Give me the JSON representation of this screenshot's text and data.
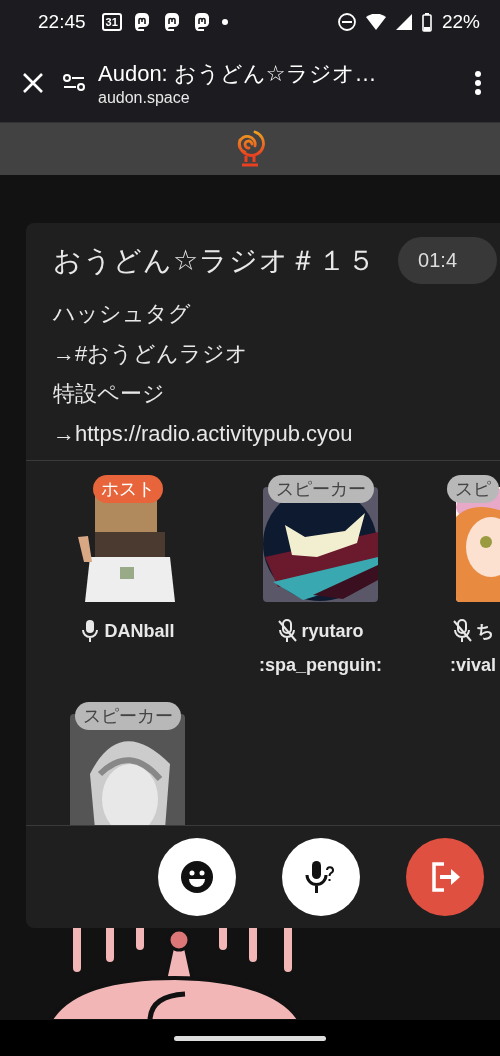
{
  "status_bar": {
    "time": "22:45",
    "calendar_day": "31",
    "battery": "22%"
  },
  "browser": {
    "title": "Audon: おうどん☆ラジオ…",
    "url": "audon.space"
  },
  "room": {
    "title": "おうどん☆ラジオ＃１５",
    "timer": "01:4",
    "description": [
      "ハッシュタグ",
      "→#おうどんラジオ",
      "特設ページ",
      "→https://radio.activitypub.cyou"
    ],
    "participants": [
      {
        "badge": "ホスト",
        "color": "#e8643a",
        "muted": false,
        "name_lines": [
          "DANball"
        ]
      },
      {
        "badge": "スピーカー",
        "color": "#b8b8b8",
        "muted": true,
        "name_lines": [
          "ryutaro",
          ":spa_penguin:"
        ]
      },
      {
        "badge": "スピ",
        "color": "#b8b8b8",
        "muted": true,
        "name_lines": [
          "ち",
          ":vival"
        ]
      },
      {
        "badge": "スピーカー",
        "color": "#b8b8b8"
      }
    ],
    "controls": [
      {
        "kind": "emoji"
      },
      {
        "kind": "request_mic"
      },
      {
        "kind": "leave"
      }
    ]
  }
}
